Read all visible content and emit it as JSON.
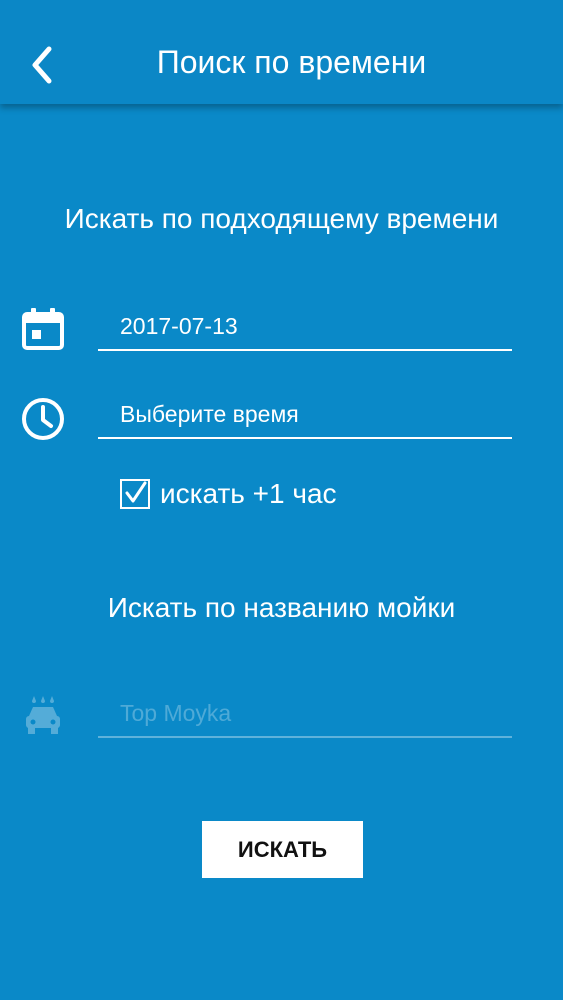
{
  "header": {
    "back_icon": "chevron-left-icon",
    "title": "Поиск по времени"
  },
  "time_section": {
    "title": "Искать по подходящему времени",
    "date_icon": "calendar-icon",
    "date_value": "2017-07-13",
    "time_icon": "clock-icon",
    "time_placeholder": "Выберите время",
    "plus_hour_checked": true,
    "plus_hour_label": "искать +1 час"
  },
  "name_section": {
    "title": "Искать по названию мойки",
    "carwash_icon": "car-wash-icon",
    "name_placeholder": "Top Moyka"
  },
  "search_button": {
    "label": "ИСКАТЬ"
  },
  "colors": {
    "background": "#0a89c8",
    "text": "#ffffff",
    "button_bg": "#ffffff"
  }
}
